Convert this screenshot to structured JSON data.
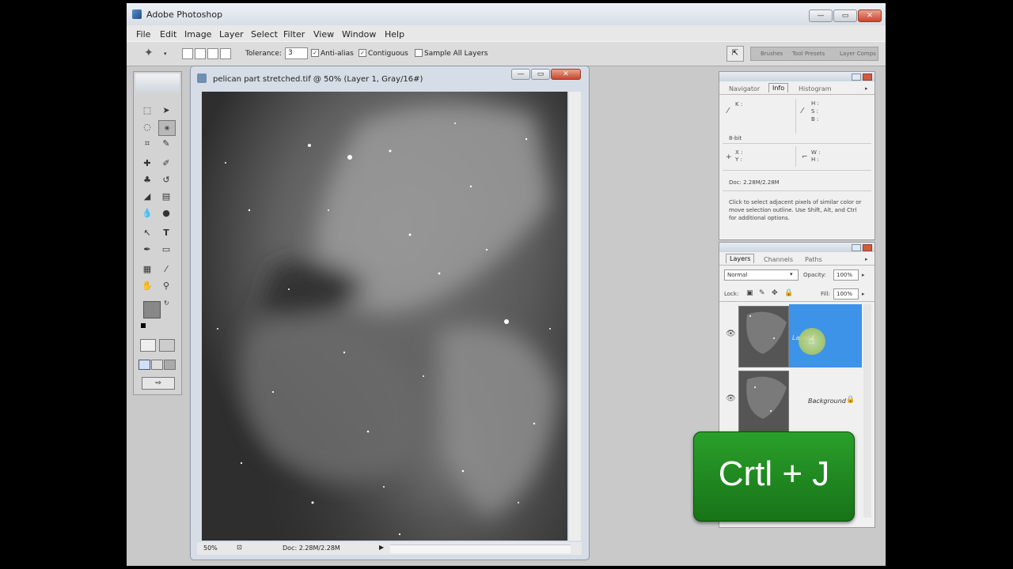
{
  "app": {
    "title": "Adobe Photoshop",
    "window_buttons": {
      "minimize": "—",
      "maximize": "▭",
      "close": "✕"
    }
  },
  "menu": [
    "File",
    "Edit",
    "Image",
    "Layer",
    "Select",
    "Filter",
    "View",
    "Window",
    "Help"
  ],
  "options_bar": {
    "tolerance_label": "Tolerance:",
    "tolerance_value": "3",
    "anti_alias_label": "Anti-alias",
    "anti_alias_checked": true,
    "contiguous_label": "Contiguous",
    "contiguous_checked": true,
    "sample_all_layers_label": "Sample All Layers",
    "sample_all_layers_checked": false,
    "well_tabs": [
      "Brushes",
      "Tool Presets",
      "Layer Comps"
    ]
  },
  "document": {
    "title": "pelican part stretched.tif @ 50% (Layer 1, Gray/16#)",
    "zoom": "50%",
    "doc_size": "Doc: 2.28M/2.28M"
  },
  "info_panel": {
    "tabs": [
      "Navigator",
      "Info",
      "Histogram"
    ],
    "active_tab": "Info",
    "k_label": "K :",
    "hsb_labels": [
      "H :",
      "S :",
      "B :"
    ],
    "bit_depth": "8-bit",
    "xy_labels": [
      "X :",
      "Y :"
    ],
    "wh_labels": [
      "W :",
      "H :"
    ],
    "doc_size": "Doc: 2.28M/2.28M",
    "help_text": "Click to select adjacent pixels of similar color or move selection outline.  Use Shift, Alt, and Ctrl for additional options."
  },
  "layers_panel": {
    "tabs": [
      "Layers",
      "Channels",
      "Paths"
    ],
    "active_tab": "Layers",
    "blend_mode": "Normal",
    "opacity_label": "Opacity:",
    "opacity_value": "100%",
    "lock_label": "Lock:",
    "fill_label": "Fill:",
    "fill_value": "100%",
    "layers": [
      {
        "name": "Layer 1",
        "selected": true,
        "visible": true
      },
      {
        "name": "Background",
        "selected": false,
        "visible": true,
        "locked": true
      }
    ]
  },
  "shortcut_overlay": {
    "text": "Crtl + J"
  },
  "colors": {
    "selected_layer": "#3d93e8",
    "overlay_green": "#1e8a1e",
    "app_bg": "#c9c9c9"
  }
}
